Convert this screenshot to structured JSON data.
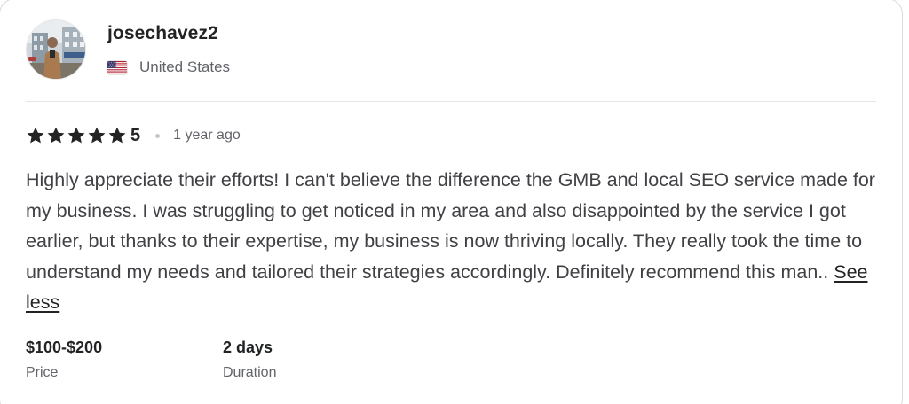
{
  "reviewer": {
    "username": "josechavez2",
    "country": "United States",
    "flag_icon": "us-flag-icon",
    "avatar_icon": "avatar-photo"
  },
  "review": {
    "rating_value": "5",
    "star_count": 5,
    "star_icon": "star-icon",
    "star_color": "#222325",
    "time_ago": "1 year ago",
    "text": "Highly appreciate their efforts! I can't believe the difference the GMB and local SEO service made for my business. I was struggling to get noticed in my area and also disappointed by the service I got earlier, but thanks to their expertise, my business is now thriving locally. They really took the time to understand my needs and tailored their strategies accordingly. Definitely recommend this man.. ",
    "see_less_label": "See less"
  },
  "meta": {
    "price_value": "$100-$200",
    "price_label": "Price",
    "duration_value": "2 days",
    "duration_label": "Duration"
  }
}
